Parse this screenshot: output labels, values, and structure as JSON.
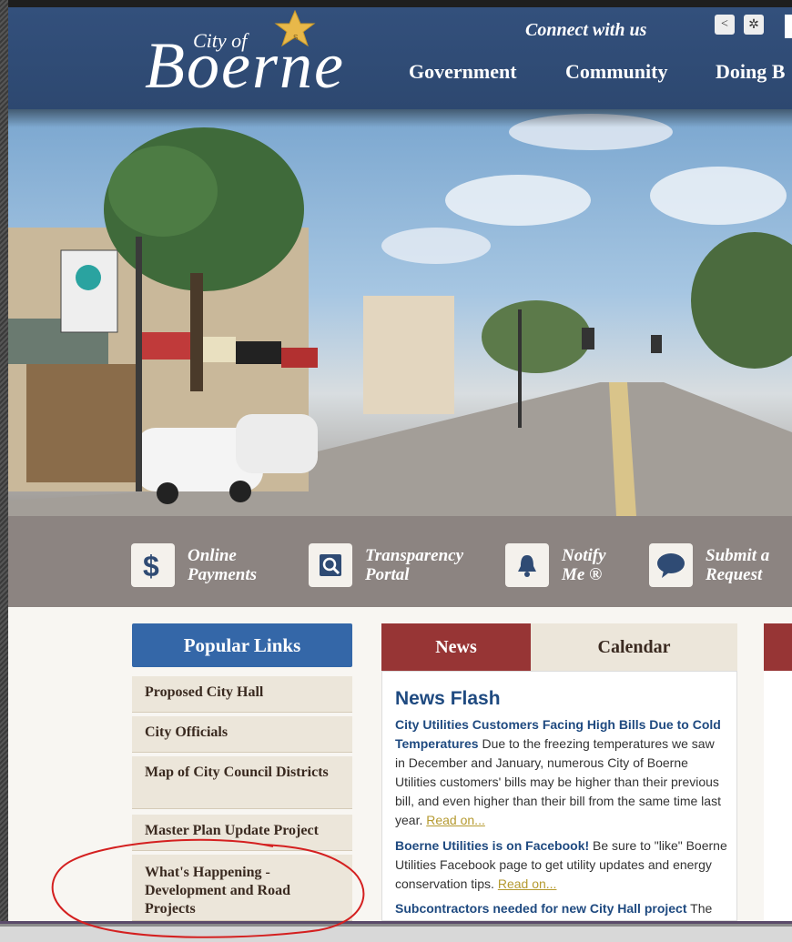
{
  "header": {
    "logo_city_of": "City of",
    "logo_name": "Boerne",
    "connect": "Connect with us",
    "share_icon": "share-icon",
    "settings_icon": "settings-icon",
    "nav": [
      "Government",
      "Community",
      "Doing B"
    ]
  },
  "quick_links": [
    {
      "label": "Online\nPayments",
      "icon": "dollar-icon"
    },
    {
      "label": "Transparency\nPortal",
      "icon": "magnifier-icon"
    },
    {
      "label": "Notify\nMe ®",
      "icon": "bell-icon"
    },
    {
      "label": "Submit a\nRequest",
      "icon": "speech-bubble-icon"
    }
  ],
  "popular_links": {
    "title": "Popular Links",
    "items": [
      "Proposed City Hall",
      "City Officials",
      "Map of City Council Districts",
      "Master Plan Update Project",
      "What's Happening - Development and Road Projects"
    ]
  },
  "tabs": {
    "news": "News",
    "calendar": "Calendar"
  },
  "news": {
    "title": "News Flash",
    "items": [
      {
        "headline": "City Utilities Customers Facing High Bills Due to Cold Temperatures",
        "body": " Due to the freezing temperatures we saw in December and January, numerous City of Boerne Utilities customers' bills may be higher than their previous bill, and even higher than their bill from the same time last year. ",
        "more": "Read on..."
      },
      {
        "headline": "Boerne Utilities is on Facebook!",
        "body": " Be sure to \"like\" Boerne Utilities Facebook page to get utility updates and energy conservation tips. ",
        "more": "Read on..."
      },
      {
        "headline": "Subcontractors needed for new City Hall project",
        "body": " The",
        "more": ""
      }
    ]
  },
  "colors": {
    "header_blue": "#2f4b74",
    "popular_links_blue": "#3467a8",
    "news_red": "#973535",
    "link_gold": "#b59a30",
    "annotation_red": "#d42020"
  }
}
